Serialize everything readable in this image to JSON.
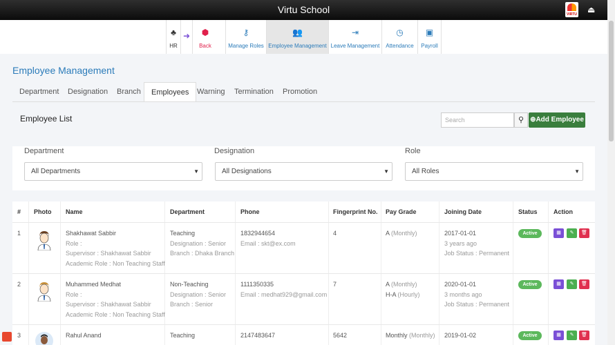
{
  "app": {
    "title": "Virtu School",
    "logo_text": "VIRTU"
  },
  "modules": {
    "hr": "HR",
    "back": "Back",
    "items": [
      "Manage Roles",
      "Employee Management",
      "Leave Management",
      "Attendance",
      "Payroll"
    ],
    "active": "Employee Management"
  },
  "page": {
    "title": "Employee Management"
  },
  "tabs": [
    "Department",
    "Designation",
    "Branch",
    "Employees",
    "Warning",
    "Termination",
    "Promotion"
  ],
  "active_tab": "Employees",
  "list": {
    "title": "Employee List",
    "search_placeholder": "Search",
    "add_label": "Add Employee"
  },
  "filters": [
    {
      "label": "Department",
      "value": "All Departments"
    },
    {
      "label": "Designation",
      "value": "All Designations"
    },
    {
      "label": "Role",
      "value": "All Roles"
    }
  ],
  "table": {
    "headers": [
      "#",
      "Photo",
      "Name",
      "Department",
      "Phone",
      "Fingerprint No.",
      "Pay Grade",
      "Joining Date",
      "Status",
      "Action"
    ],
    "rows": [
      {
        "num": "1",
        "name": "Shakhawat Sabbir",
        "role": "Role :",
        "supervisor": "Supervisor : Shakhawat Sabbir",
        "academic_role": "Academic Role : Non Teaching Staff",
        "department": "Teaching",
        "designation": "Designation : Senior",
        "branch": "Branch : Dhaka Branch",
        "phone": "1832944654",
        "email": "Email : skt@ex.com",
        "fingerprint": "4",
        "pay_grade_1": "A",
        "pay_grade_1_type": "(Monthly)",
        "pay_grade_2": "",
        "pay_grade_2_type": "",
        "joining_date": "2017-01-01",
        "duration": "3 years ago",
        "job_status": "Job Status : Permanent",
        "status": "Active"
      },
      {
        "num": "2",
        "name": "Muhammed Medhat",
        "role": "Role :",
        "supervisor": "Supervisor : Shakhawat Sabbir",
        "academic_role": "Academic Role : Non Teaching Staff",
        "department": "Non-Teaching",
        "designation": "Designation : Senior",
        "branch": "Branch : Senior",
        "phone": "1111350335",
        "email": "Email : medhat929@gmail.com",
        "fingerprint": "7",
        "pay_grade_1": "A",
        "pay_grade_1_type": "(Monthly)",
        "pay_grade_2": "H-A",
        "pay_grade_2_type": "(Hourly)",
        "joining_date": "2020-01-01",
        "duration": "3 months ago",
        "job_status": "Job Status : Permanent",
        "status": "Active"
      },
      {
        "num": "3",
        "name": "Rahul Anand",
        "department": "Teaching",
        "phone": "2147483647",
        "fingerprint": "5642",
        "pay_grade_1": "Monthly",
        "pay_grade_1_type": "(Monthly)",
        "joining_date": "2019-01-02",
        "status": "Active"
      }
    ]
  }
}
